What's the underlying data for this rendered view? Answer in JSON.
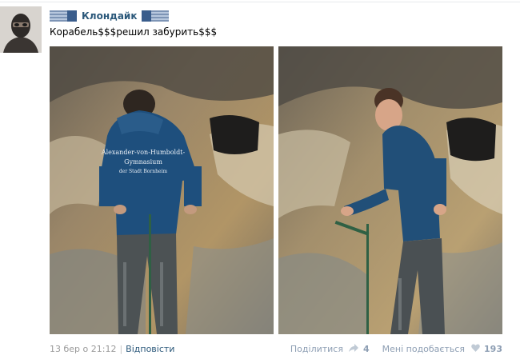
{
  "post": {
    "author": "Клондайк",
    "text": "Корабель$$$решил забурить$$$",
    "date": "13 бер о 21:12",
    "reply_label": "Відповісти",
    "share_label": "Поділитися",
    "share_count": "4",
    "like_label": "Мені подобається",
    "like_count": "193"
  },
  "photos": {
    "left": {
      "hoodie_text_line1": "Alexander-von-Humboldt-",
      "hoodie_text_line2": "Gymnasium",
      "hoodie_text_line3": "der Stadt Bornheim"
    }
  },
  "icons": [
    "flag-icon",
    "share-icon",
    "heart-icon"
  ],
  "colors": {
    "link": "#2b587a",
    "meta": "#999999",
    "action": "#8d9eb3"
  }
}
